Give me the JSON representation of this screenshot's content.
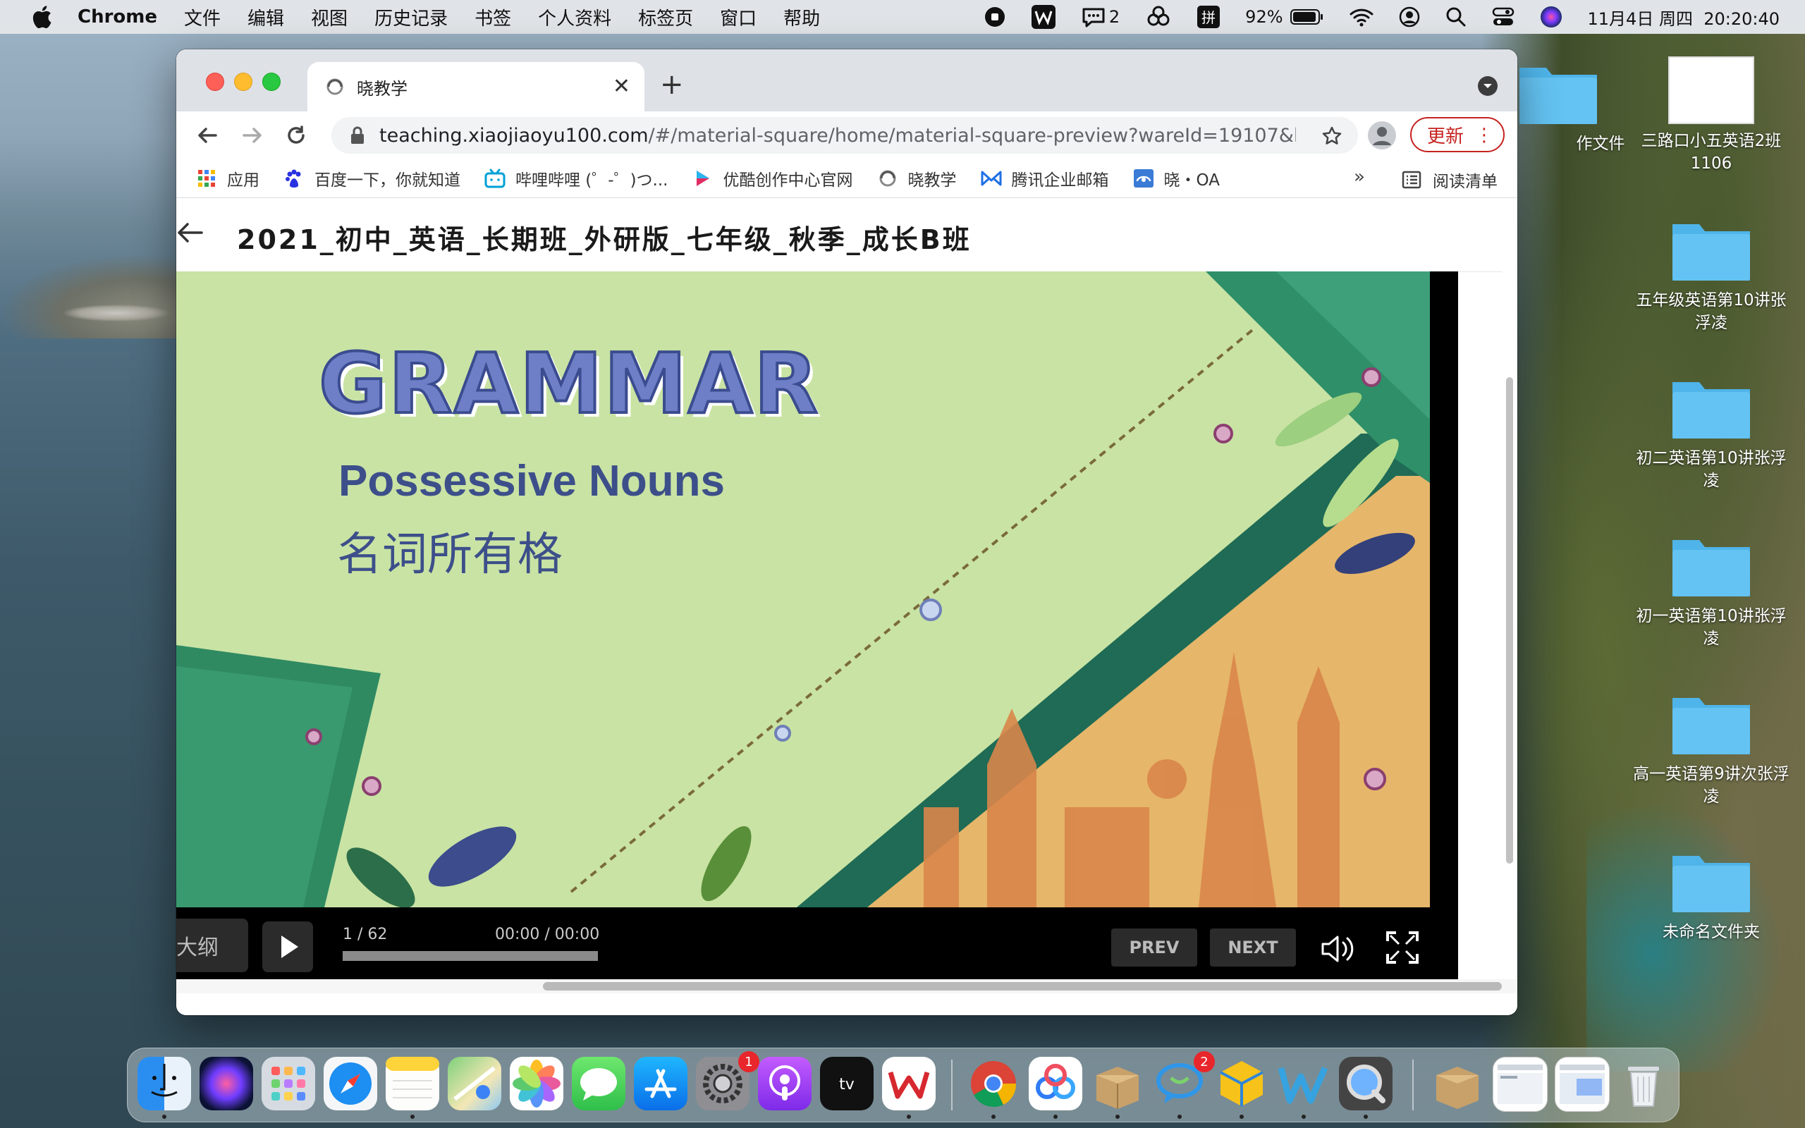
{
  "menubar": {
    "items": [
      "Chrome",
      "文件",
      "编辑",
      "视图",
      "历史记录",
      "书签",
      "个人资料",
      "标签页",
      "窗口",
      "帮助"
    ],
    "status": {
      "notif_count": "2",
      "battery": "92%",
      "datetime": "11月4日 周四  20:20:40"
    }
  },
  "browser": {
    "tab_title": "晓教学",
    "url_host": "teaching.xiaojiaoyu100.com",
    "url_path": "/#/material-square/home/material-square-preview?wareId=19107&les...",
    "update_label": "更新",
    "bookmarks": [
      "应用",
      "百度一下，你就知道",
      "哔哩哔哩 (゜-゜)つ...",
      "优酷创作中心官网",
      "晓教学",
      "腾讯企业邮箱",
      "晓・OA"
    ],
    "more_label": "»",
    "reading_list": "阅读清单"
  },
  "page": {
    "course_title": "2021_初中_英语_长期班_外研版_七年级_秋季_成长B班"
  },
  "slide": {
    "heading": "GRAMMAR",
    "subtitle_en": "Possessive Nouns",
    "subtitle_zh": "名词所有格"
  },
  "player": {
    "outline_label": "大纲",
    "page_counter": "1 / 62",
    "time": "00:00 / 00:00",
    "prev_label": "PREV",
    "next_label": "NEXT"
  },
  "desktop": {
    "icons": [
      "作文件",
      "三路口小五英语2班1106",
      "五年级英语第10讲张浮凌",
      "初二英语第10讲张浮凌",
      "初一英语第10讲张浮凌",
      "高一英语第9讲次张浮凌",
      "未命名文件夹"
    ]
  },
  "dock": {
    "settings_badge": "1",
    "chat_badge": "2"
  }
}
